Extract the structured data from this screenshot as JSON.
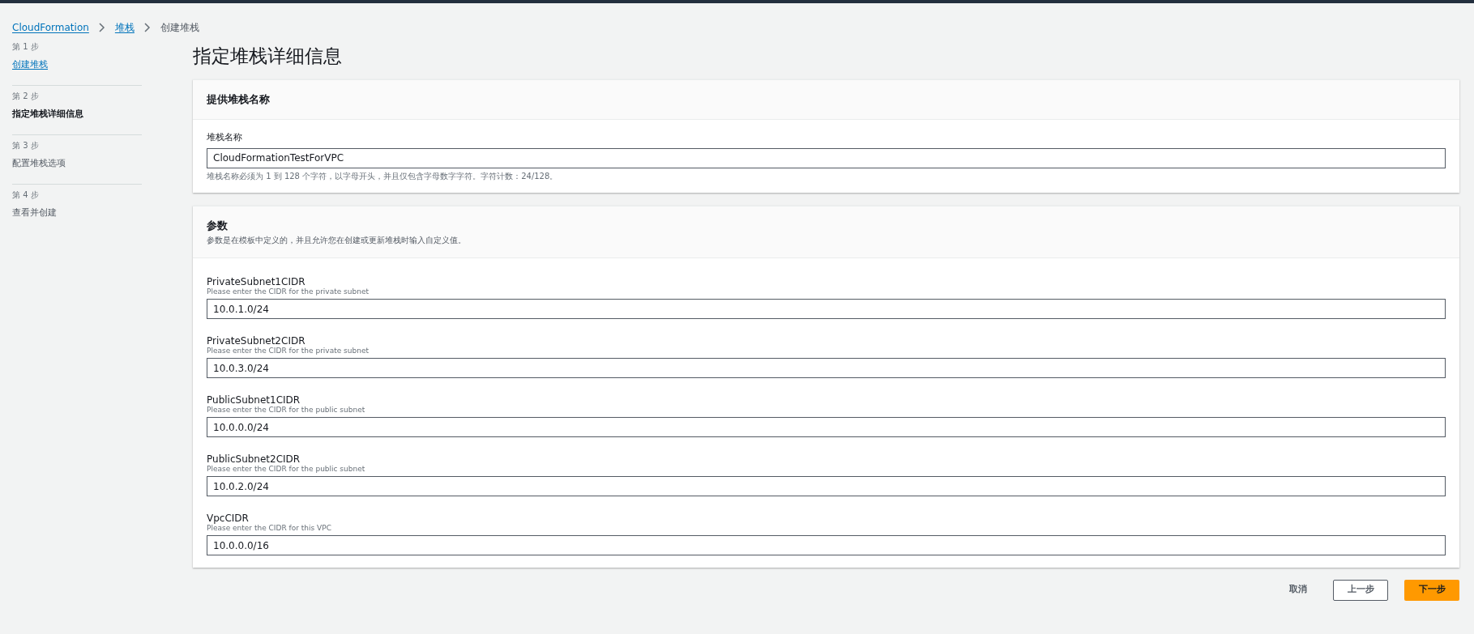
{
  "breadcrumb": [
    {
      "label": "CloudFormation",
      "kind": "link"
    },
    {
      "label": "堆栈",
      "kind": "link"
    },
    {
      "label": "创建堆栈",
      "kind": "current"
    }
  ],
  "steps": [
    {
      "number": "第 1 步",
      "label": "创建堆栈",
      "kind": "completed"
    },
    {
      "number": "第 2 步",
      "label": "指定堆栈详细信息",
      "kind": "current"
    },
    {
      "number": "第 3 步",
      "label": "配置堆栈选项",
      "kind": "upcoming"
    },
    {
      "number": "第 4 步",
      "label": "查看并创建",
      "kind": "upcoming"
    }
  ],
  "page_title": "指定堆栈详细信息",
  "stack_name_section": {
    "title": "提供堆栈名称",
    "field_label": "堆栈名称",
    "value": "CloudFormationTestForVPC",
    "hint": "堆栈名称必须为 1 到 128 个字符，以字母开头，并且仅包含字母数字字符。字符计数：24/128。"
  },
  "parameters_section": {
    "title": "参数",
    "description": "参数是在模板中定义的，并且允许您在创建或更新堆栈时输入自定义值。",
    "parameters": [
      {
        "name": "PrivateSubnet1CIDR",
        "description": "Please enter the CIDR for the private subnet",
        "value": "10.0.1.0/24"
      },
      {
        "name": "PrivateSubnet2CIDR",
        "description": "Please enter the CIDR for the private subnet",
        "value": "10.0.3.0/24"
      },
      {
        "name": "PublicSubnet1CIDR",
        "description": "Please enter the CIDR for the public subnet",
        "value": "10.0.0.0/24"
      },
      {
        "name": "PublicSubnet2CIDR",
        "description": "Please enter the CIDR for the public subnet",
        "value": "10.0.2.0/24"
      },
      {
        "name": "VpcCIDR",
        "description": "Please enter the CIDR for this VPC",
        "value": "10.0.0.0/16"
      }
    ]
  },
  "buttons": [
    {
      "label": "取消",
      "kind": "link"
    },
    {
      "label": "上一步",
      "kind": "secondary"
    },
    {
      "label": "下一步",
      "kind": "primary"
    }
  ]
}
